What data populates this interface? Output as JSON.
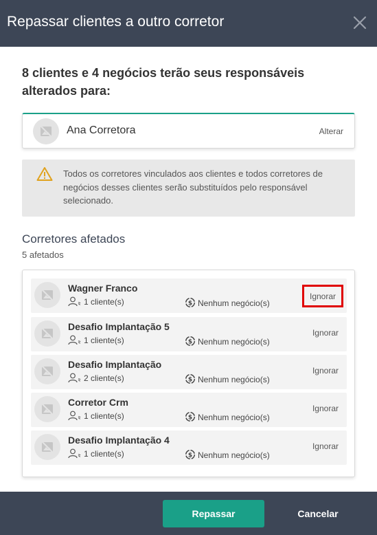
{
  "modal": {
    "title": "Repassar clientes a outro corretor",
    "close_icon": "close-icon"
  },
  "summary": {
    "heading": "8 clientes e 4 negócios terão seus responsáveis alterados para:"
  },
  "selected_broker": {
    "name": "Ana Corretora",
    "alter_label": "Alterar",
    "avatar_icon": "image-placeholder-icon"
  },
  "warning": {
    "icon": "warning-triangle-icon",
    "text": "Todos os corretores vinculados aos clientes e todos corretores de negócios desses clientes serão substituídos pelo responsável selecionado."
  },
  "affected": {
    "title": "Corretores afetados",
    "count_label": "5 afetados",
    "brokers": [
      {
        "name": "Wagner Franco",
        "clients": "1 cliente(s)",
        "deals": "Nenhum negócio(s)",
        "ignore_label": "Ignorar"
      },
      {
        "name": "Desafio Implantação 5",
        "clients": "1 cliente(s)",
        "deals": "Nenhum negócio(s)",
        "ignore_label": "Ignorar"
      },
      {
        "name": "Desafio Implantação",
        "clients": "2 cliente(s)",
        "deals": "Nenhum negócio(s)",
        "ignore_label": "Ignorar"
      },
      {
        "name": "Corretor Crm",
        "clients": "1 cliente(s)",
        "deals": "Nenhum negócio(s)",
        "ignore_label": "Ignorar"
      },
      {
        "name": "Desafio Implantação 4",
        "clients": "1 cliente(s)",
        "deals": "Nenhum negócio(s)",
        "ignore_label": "Ignorar"
      }
    ]
  },
  "footer": {
    "confirm_label": "Repassar",
    "cancel_label": "Cancelar"
  },
  "colors": {
    "header_bg": "#3d4656",
    "accent": "#1aa088",
    "warning_icon": "#e0a21e",
    "highlight_border": "#e00000"
  }
}
